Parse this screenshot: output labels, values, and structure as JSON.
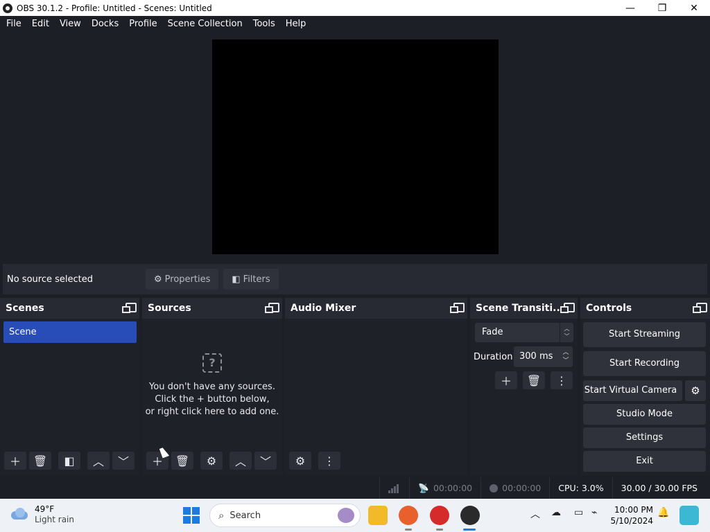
{
  "window": {
    "title": "OBS 30.1.2 - Profile: Untitled - Scenes: Untitled",
    "controls": {
      "minimize": "—",
      "maximize": "❐",
      "close": "✕"
    }
  },
  "menu": [
    "File",
    "Edit",
    "View",
    "Docks",
    "Profile",
    "Scene Collection",
    "Tools",
    "Help"
  ],
  "source_bar": {
    "status": "No source selected",
    "properties_label": "Properties",
    "filters_label": "Filters"
  },
  "scenes": {
    "title": "Scenes",
    "items": [
      "Scene"
    ]
  },
  "sources": {
    "title": "Sources",
    "empty_line1": "You don't have any sources.",
    "empty_line2": "Click the + button below,",
    "empty_line3": "or right click here to add one."
  },
  "audio_mixer": {
    "title": "Audio Mixer"
  },
  "scene_transitions": {
    "title": "Scene Transiti...",
    "selected": "Fade",
    "duration_label": "Duration",
    "duration_value": "300 ms"
  },
  "controls": {
    "title": "Controls",
    "start_streaming": "Start Streaming",
    "start_recording": "Start Recording",
    "start_virtual_camera": "Start Virtual Camera",
    "studio_mode": "Studio Mode",
    "settings": "Settings",
    "exit": "Exit"
  },
  "status": {
    "stream_time": "00:00:00",
    "record_time": "00:00:00",
    "cpu": "CPU: 3.0%",
    "fps": "30.00 / 30.00 FPS"
  },
  "taskbar": {
    "weather_temp": "49°F",
    "weather_condition": "Light rain",
    "search_placeholder": "Search",
    "time": "10:00 PM",
    "date": "5/10/2024"
  },
  "colors": {
    "accent_selected": "#284cb8",
    "dock_bg": "#272a33",
    "window_bg": "#1d1f26"
  }
}
